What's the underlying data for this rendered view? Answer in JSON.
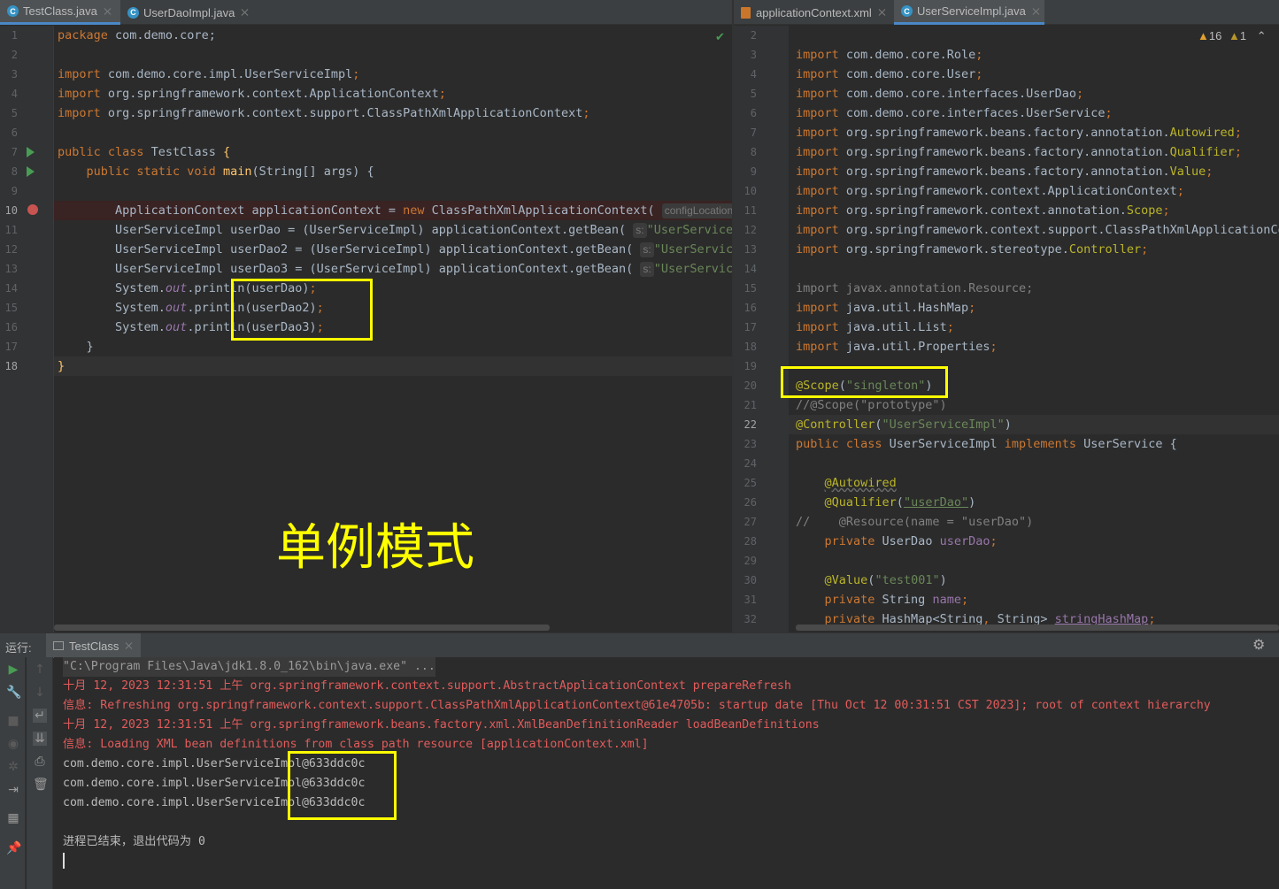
{
  "left_tabs": [
    {
      "label": "TestClass.java",
      "icon": "java-class-icon",
      "active": true
    },
    {
      "label": "UserDaoImpl.java",
      "icon": "java-class-icon",
      "active": false
    }
  ],
  "right_tabs": [
    {
      "label": "applicationContext.xml",
      "icon": "xml-file-icon",
      "active": false
    },
    {
      "label": "UserServiceImpl.java",
      "icon": "java-class-icon",
      "active": true
    }
  ],
  "left_editor": {
    "line_numbers": [
      "1",
      "2",
      "3",
      "4",
      "5",
      "6",
      "7",
      "8",
      "9",
      "10",
      "11",
      "12",
      "13",
      "14",
      "15",
      "16",
      "17",
      "18"
    ],
    "lines": [
      "package com.demo.core;",
      "",
      "import com.demo.core.impl.UserServiceImpl;",
      "import org.springframework.context.ApplicationContext;",
      "import org.springframework.context.support.ClassPathXmlApplicationContext;",
      "",
      "public class TestClass {",
      "    public static void main(String[] args) {",
      "",
      "        ApplicationContext applicationContext = new ClassPathXmlApplicationContext(",
      "        UserServiceImpl userDao = (UserServiceImpl) applicationContext.getBean(",
      "        UserServiceImpl userDao2 = (UserServiceImpl) applicationContext.getBean(",
      "        UserServiceImpl userDao3 = (UserServiceImpl) applicationContext.getBean(",
      "        System.out.println(userDao);",
      "        System.out.println(userDao2);",
      "        System.out.println(userDao3);",
      "    }",
      "}"
    ],
    "hint_config": "configLocation:",
    "hint_s": "s:",
    "hint_string": "\"UserServiceIm"
  },
  "overlay_text": "单例模式",
  "right_editor": {
    "warnings": "16",
    "weak_warnings": "1",
    "line_numbers": [
      "2",
      "3",
      "4",
      "5",
      "6",
      "7",
      "8",
      "9",
      "10",
      "11",
      "12",
      "13",
      "14",
      "15",
      "16",
      "17",
      "18",
      "19",
      "20",
      "21",
      "22",
      "23",
      "24",
      "25",
      "26",
      "27",
      "28",
      "29",
      "30",
      "31",
      "32"
    ]
  },
  "run_panel": {
    "label": "运行:",
    "tab": "TestClass"
  },
  "console": [
    {
      "text": "\"C:\\Program Files\\Java\\jdk1.8.0_162\\bin\\java.exe\" ...",
      "kind": "cmd"
    },
    {
      "text": "十月 12, 2023 12:31:51 上午 org.springframework.context.support.AbstractApplicationContext prepareRefresh",
      "kind": "err"
    },
    {
      "text": "信息: Refreshing org.springframework.context.support.ClassPathXmlApplicationContext@61e4705b: startup date [Thu Oct 12 00:31:51 CST 2023]; root of context hierarchy",
      "kind": "err"
    },
    {
      "text": "十月 12, 2023 12:31:51 上午 org.springframework.beans.factory.xml.XmlBeanDefinitionReader loadBeanDefinitions",
      "kind": "err"
    },
    {
      "text": "信息: Loading XML bean definitions from class path resource [applicationContext.xml]",
      "kind": "err"
    },
    {
      "text": "com.demo.core.impl.UserServiceImpl@633ddc0c",
      "kind": "out"
    },
    {
      "text": "com.demo.core.impl.UserServiceImpl@633ddc0c",
      "kind": "out"
    },
    {
      "text": "com.demo.core.impl.UserServiceImpl@633ddc0c",
      "kind": "out"
    },
    {
      "text": "",
      "kind": "out"
    },
    {
      "text": "进程已结束，退出代码为 0",
      "kind": "out"
    }
  ],
  "colors": {
    "accent": "#4a88c7",
    "highlight_box": "#ffff00",
    "error_text": "#e35b5b"
  }
}
